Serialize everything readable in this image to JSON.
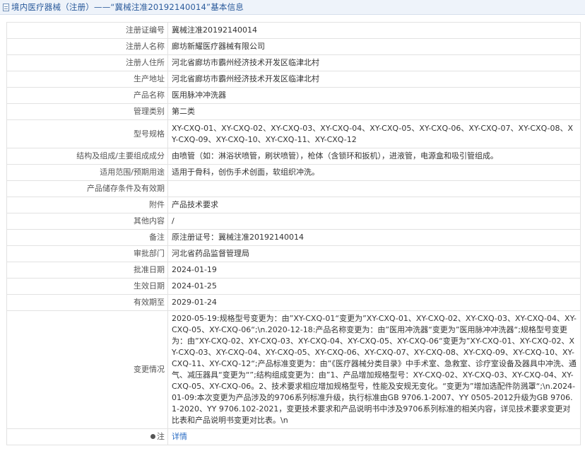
{
  "header": {
    "title": "境内医疗器械（注册）——“冀械注准20192140014”基本信息"
  },
  "rows": [
    {
      "label": "注册证编号",
      "value": "冀械注准20192140014"
    },
    {
      "label": "注册人名称",
      "value": "廊坊新耀医疗器械有限公司"
    },
    {
      "label": "注册人住所",
      "value": "河北省廊坊市霸州经济技术开发区临津北村"
    },
    {
      "label": "生产地址",
      "value": "河北省廊坊市霸州经济技术开发区临津北村"
    },
    {
      "label": "产品名称",
      "value": "医用脉冲冲洗器"
    },
    {
      "label": "管理类别",
      "value": "第二类"
    },
    {
      "label": "型号规格",
      "value": "XY-CXQ-01、XY-CXQ-02、XY-CXQ-03、XY-CXQ-04、XY-CXQ-05、XY-CXQ-06、XY-CXQ-07、XY-CXQ-08、XY-CXQ-09、XY-CXQ-10、XY-CXQ-11、XY-CXQ-12"
    },
    {
      "label": "结构及组成/主要组成成分",
      "value": "由喷管（如：淋浴状喷管，刷状喷管），枪体（含锁环和扳机），进液管，电源盒和吸引管组成。"
    },
    {
      "label": "适用范围/预期用途",
      "value": "适用于骨科，创伤手术创面，软组织冲洗。"
    },
    {
      "label": "产品储存条件及有效期",
      "value": ""
    },
    {
      "label": "附件",
      "value": "产品技术要求"
    },
    {
      "label": "其他内容",
      "value": "/"
    },
    {
      "label": "备注",
      "value": "原注册证号：冀械注准20192140014"
    },
    {
      "label": "审批部门",
      "value": "河北省药品监督管理局"
    },
    {
      "label": "批准日期",
      "value": "2024-01-19"
    },
    {
      "label": "生效日期",
      "value": "2024-01-25"
    },
    {
      "label": "有效期至",
      "value": "2029-01-24"
    },
    {
      "label": "变更情况",
      "value": "2020-05-19:规格型号变更为：由”XY-CXQ-01“变更为”XY-CXQ-01、XY-CXQ-02、XY-CXQ-03、XY-CXQ-04、XY-CXQ-05、XY-CXQ-06“;\\n.2020-12-18:产品名称变更为：由”医用冲洗器“变更为”医用脉冲冲洗器“;规格型号变更为：由”XY-CXQ-02、XY-CXQ-03、XY-CXQ-04、XY-CXQ-05、XY-CXQ-06“变更为”XY-CXQ-01、XY-CXQ-02、XY-CXQ-03、XY-CXQ-04、XY-CXQ-05、XY-CXQ-06、XY-CXQ-07、XY-CXQ-08、XY-CXQ-09、XY-CXQ-10、XY-CXQ-11、XY-CXQ-12“;产品标准变更为：由”《医疗器械分类目录》中手术室、急救室、诊疗室设备及器具中冲洗、通气、减压器具“变更为“”;结构组成变更为：由”1、产品增加规格型号：XY-CXQ-02、XY-CXQ-03、XY-CXQ-04、XY-CXQ-05、XY-CXQ-06。2、技术要求相应增加规格型号，性能及安规无变化。“变更为”增加选配件防溅罩“;\\n.2024-01-09:本次变更为产品涉及的9706系列标准升级，执行标准由GB 9706.1-2007、YY 0505-2012升级为GB 9706.1-2020、YY 9706.102-2021，变更技术要求和产品说明书中涉及9706系列标准的相关内容，详见技术要求变更对比表和产品说明书变更对比表。\\n"
    },
    {
      "label": "注",
      "value": "详情"
    }
  ],
  "icons": {
    "note_icon": "pin-icon",
    "title_icon": "document-icon"
  },
  "colors": {
    "title": "#2a5a9b",
    "link": "#2a6cc4",
    "header_bg": "#eef3fa"
  }
}
